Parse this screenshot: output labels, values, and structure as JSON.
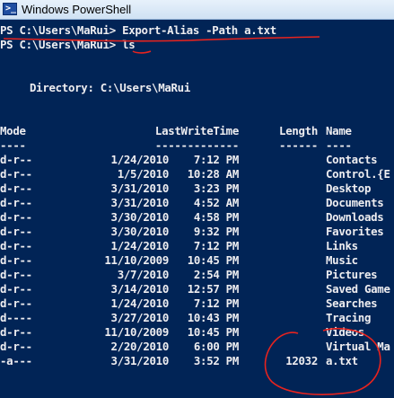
{
  "window": {
    "title": "Windows PowerShell",
    "icon": "powershell-icon"
  },
  "console": {
    "lines": [
      {
        "prompt": "PS C:\\Users\\MaRui>",
        "command": "Export-Alias -Path a.txt"
      },
      {
        "prompt": "PS C:\\Users\\MaRui>",
        "command": "ls"
      }
    ],
    "directory_line": "Directory: C:\\Users\\MaRui",
    "headers": {
      "mode": "Mode",
      "last_write_time": "LastWriteTime",
      "length": "Length",
      "name": "Name"
    },
    "underlines": {
      "mode": "----",
      "last_write_time": "-------------",
      "length": "------",
      "name": "----"
    },
    "rows": [
      {
        "mode": "d-r--",
        "date": "1/24/2010",
        "time": "7:12 PM",
        "length": "",
        "name": "Contacts"
      },
      {
        "mode": "d-r--",
        "date": "1/5/2010",
        "time": "10:28 AM",
        "length": "",
        "name": "Control.{E"
      },
      {
        "mode": "d-r--",
        "date": "3/31/2010",
        "time": "3:23 PM",
        "length": "",
        "name": "Desktop"
      },
      {
        "mode": "d-r--",
        "date": "3/31/2010",
        "time": "4:52 AM",
        "length": "",
        "name": "Documents"
      },
      {
        "mode": "d-r--",
        "date": "3/30/2010",
        "time": "4:58 PM",
        "length": "",
        "name": "Downloads"
      },
      {
        "mode": "d-r--",
        "date": "3/30/2010",
        "time": "9:32 PM",
        "length": "",
        "name": "Favorites"
      },
      {
        "mode": "d-r--",
        "date": "1/24/2010",
        "time": "7:12 PM",
        "length": "",
        "name": "Links"
      },
      {
        "mode": "d-r--",
        "date": "11/10/2009",
        "time": "10:45 PM",
        "length": "",
        "name": "Music"
      },
      {
        "mode": "d-r--",
        "date": "3/7/2010",
        "time": "2:54 PM",
        "length": "",
        "name": "Pictures"
      },
      {
        "mode": "d-r--",
        "date": "3/14/2010",
        "time": "12:57 PM",
        "length": "",
        "name": "Saved Game"
      },
      {
        "mode": "d-r--",
        "date": "1/24/2010",
        "time": "7:12 PM",
        "length": "",
        "name": "Searches"
      },
      {
        "mode": "d----",
        "date": "3/27/2010",
        "time": "10:43 PM",
        "length": "",
        "name": "Tracing"
      },
      {
        "mode": "d-r--",
        "date": "11/10/2009",
        "time": "10:45 PM",
        "length": "",
        "name": "Videos"
      },
      {
        "mode": "d-r--",
        "date": "2/20/2010",
        "time": "6:00 PM",
        "length": "",
        "name": "Virtual Ma"
      },
      {
        "mode": "-a---",
        "date": "3/31/2010",
        "time": "3:52 PM",
        "length": "12032",
        "name": "a.txt"
      }
    ]
  },
  "colors": {
    "console_background": "#012456",
    "console_text": "#eeedf0",
    "annotation": "#e8231e",
    "titlebar_top": "#e7f1fb",
    "titlebar_bottom": "#cfe1f3"
  }
}
